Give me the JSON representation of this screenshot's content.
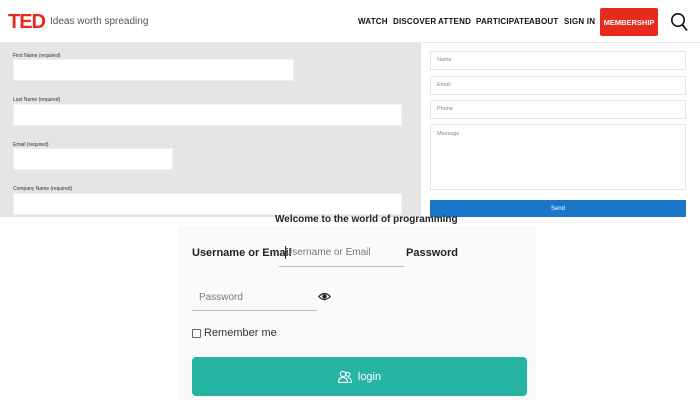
{
  "header": {
    "logo": "TED",
    "tagline": "Ideas worth spreading",
    "nav": [
      "WATCH",
      "DISCOVER",
      "ATTEND",
      "PARTICIPATE",
      "ABOUT",
      "SIGN IN"
    ],
    "membership_label": "MEMBERSHIP",
    "search_icon": "search-icon",
    "brand_color": "#e62b1e"
  },
  "grey_form": {
    "fields": [
      {
        "label": "First Name (required)"
      },
      {
        "label": "Last Name (required)"
      },
      {
        "label": "Email (required)"
      },
      {
        "label": "Company Name (required)"
      }
    ]
  },
  "contact_form": {
    "name_placeholder": "Name",
    "email_placeholder": "Email",
    "phone_placeholder": "Phone",
    "message_placeholder": "Message",
    "send_label": "Send",
    "send_color": "#1a76c8"
  },
  "login": {
    "welcome": "Welcome to the world of programming",
    "username_label": "Username or Email",
    "username_placeholder": "Username or Email",
    "password_label": "Password",
    "password_placeholder": "Password",
    "show_password_icon": "eye-icon",
    "remember_label": "Remember me",
    "login_label": "login",
    "login_icon": "users-icon",
    "button_color": "#26b4a3"
  }
}
